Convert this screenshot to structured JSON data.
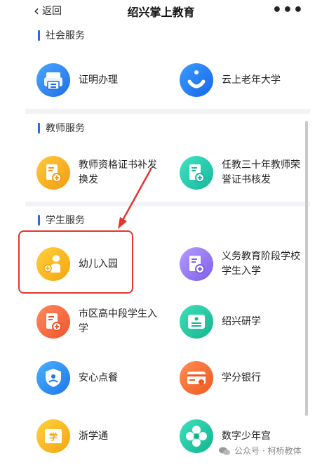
{
  "header": {
    "back_label": "返回",
    "title": "绍兴掌上教育",
    "more_label": "•••"
  },
  "sections": [
    {
      "title": "社会服务",
      "items": [
        {
          "label": "证明办理",
          "icon": "printer-icon"
        },
        {
          "label": "云上老年大学",
          "icon": "smile-icon"
        }
      ]
    },
    {
      "title": "教师服务",
      "items": [
        {
          "label": "教师资格证书补发换发",
          "icon": "certificate-icon"
        },
        {
          "label": "任教三十年教师荣誉证书核发",
          "icon": "certificate-icon"
        }
      ]
    },
    {
      "title": "学生服务",
      "items": [
        {
          "label": "幼儿入园",
          "icon": "child-icon"
        },
        {
          "label": "义务教育阶段学校学生入学",
          "icon": "certificate-icon"
        },
        {
          "label": "市区高中段学生入学",
          "icon": "certificate-icon"
        },
        {
          "label": "绍兴研学",
          "icon": "id-card-icon"
        },
        {
          "label": "安心点餐",
          "icon": "shield-icon"
        },
        {
          "label": "学分银行",
          "icon": "card-icon"
        },
        {
          "label": "浙学通",
          "icon": "book-icon"
        },
        {
          "label": "数字少年宫",
          "icon": "flower-icon"
        }
      ]
    }
  ],
  "colors": {
    "accent": "#2c6be0",
    "highlight": "#e0372a"
  },
  "watermark": "公众号 · 柯桥教体"
}
